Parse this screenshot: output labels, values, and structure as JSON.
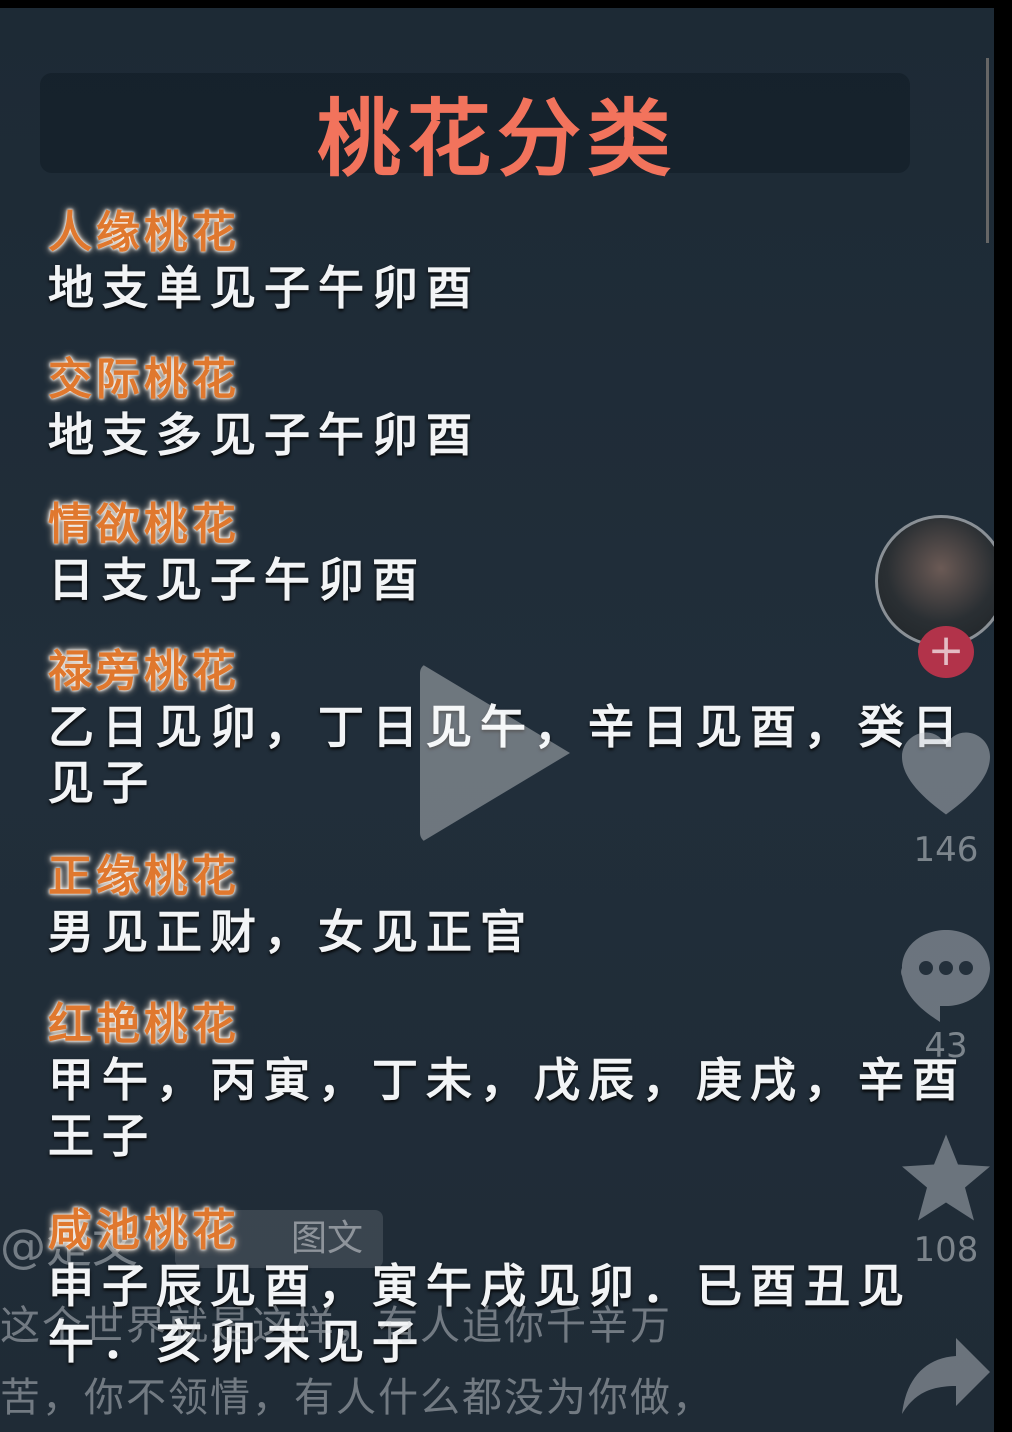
{
  "title": "桃花分类",
  "sections": [
    {
      "heading": "人缘桃花",
      "lines": [
        "地支单见子午卯酉"
      ]
    },
    {
      "heading": "交际桃花",
      "lines": [
        "地支多见子午卯酉"
      ]
    },
    {
      "heading": "情欲桃花",
      "lines": [
        "日支见子午卯酉"
      ]
    },
    {
      "heading": "禄旁桃花",
      "lines": [
        "乙日见卯，丁日见午，辛日见酉，癸日",
        "见子"
      ]
    },
    {
      "heading": "正缘桃花",
      "lines": [
        "男见正财，女见正官"
      ]
    },
    {
      "heading": "红艳桃花",
      "lines": [
        "甲午，丙寅，丁未，戊辰，庚戌，辛酉",
        "王子"
      ]
    },
    {
      "heading": "咸池桃花",
      "lines": [
        "申子辰见酉，寅午戌见卯．已酉丑见",
        "午．亥卯未见子"
      ]
    }
  ],
  "actions": {
    "likes": "146",
    "comments": "43",
    "favorites": "108",
    "follow_symbol": "+"
  },
  "author": {
    "name": "@楚文",
    "tag": "图文"
  },
  "caption": [
    "这个世界就是这样，有人追你千辛万",
    "苦，你不领情，有人什么都没为你做，"
  ],
  "colors": {
    "background": "#1f2b36",
    "title": "#f2735c",
    "heading": "#e0782e"
  }
}
